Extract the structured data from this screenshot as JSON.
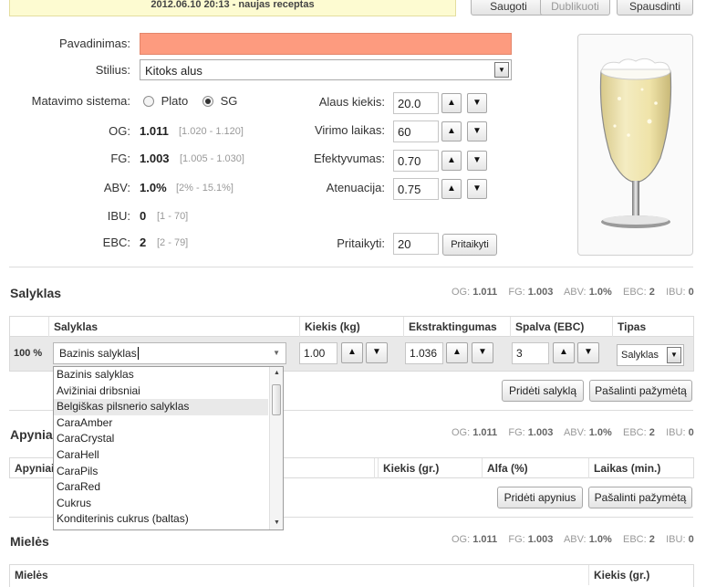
{
  "top": {
    "banner": "2012.06.10 20:13 - naujas receptas",
    "save_label": "Saugoti",
    "duplicate_label": "Dublikuoti",
    "print_label": "Spausdinti"
  },
  "recipe": {
    "name_label": "Pavadinimas:",
    "name_value": "",
    "style_label": "Stilius:",
    "style_value": "Kitoks alus",
    "measure_label": "Matavimo sistema:",
    "measure_options": [
      "Plato",
      "SG"
    ],
    "measure_selected": "SG"
  },
  "gravity": {
    "og_label": "OG:",
    "og_value": "1.011",
    "og_range": "[1.020 - 1.120]",
    "fg_label": "FG:",
    "fg_value": "1.003",
    "fg_range": "[1.005 - 1.030]",
    "abv_label": "ABV:",
    "abv_value": "1.0%",
    "abv_range": "[2% - 15.1%]",
    "ibu_label": "IBU:",
    "ibu_value": "0",
    "ibu_range": "[1 - 70]",
    "ebc_label": "EBC:",
    "ebc_value": "2",
    "ebc_range": "[2 - 79]"
  },
  "params": {
    "volume_label": "Alaus kiekis:",
    "volume_value": "20.0",
    "boil_label": "Virimo laikas:",
    "boil_value": "60",
    "eff_label": "Efektyvumas:",
    "eff_value": "0.70",
    "atten_label": "Atenuacija:",
    "atten_value": "0.75",
    "adjust_label": "Pritaikyti:",
    "adjust_value": "20",
    "adjust_button": "Pritaikyti"
  },
  "stats": {
    "og_label": "OG:",
    "og": "1.011",
    "fg_label": "FG:",
    "fg": "1.003",
    "abv_label": "ABV:",
    "abv": "1.0%",
    "ebc_label": "EBC:",
    "ebc": "2",
    "ibu_label": "IBU:",
    "ibu": "0"
  },
  "malt": {
    "title": "Salyklas",
    "headers": [
      "Salyklas",
      "Kiekis (kg)",
      "Ekstraktingumas",
      "Spalva (EBC)",
      "Tipas"
    ],
    "row": {
      "percent": "100 %",
      "name": "Bazinis salyklas",
      "amount": "1.00",
      "extract": "1.036",
      "color": "3",
      "type": "Salyklas"
    },
    "add_button": "Pridėti salyklą",
    "remove_button": "Pašalinti pažymėtą",
    "dropdown_options": [
      "Bazinis salyklas",
      "Avižiniai dribsniai",
      "Belgiškas pilsnerio salyklas",
      "CaraAmber",
      "CaraCrystal",
      "CaraHell",
      "CaraPils",
      "CaraRed",
      "Cukrus",
      "Konditerinis cukrus (baltas)"
    ],
    "dropdown_highlighted": 2
  },
  "hops": {
    "title": "Apyniai",
    "headers": [
      "Apyniai",
      "Kiekis (gr.)",
      "Alfa (%)",
      "Laikas (min.)"
    ],
    "add_button": "Pridėti apynius",
    "remove_button": "Pašalinti pažymėtą"
  },
  "yeast": {
    "title": "Mielės",
    "headers": [
      "Mielės",
      "Kiekis (gr.)"
    ]
  },
  "colors": {
    "name_field_bg": "#fd9b7f",
    "banner_bg": "#fdfbd1",
    "beer": "#efe3a8"
  }
}
